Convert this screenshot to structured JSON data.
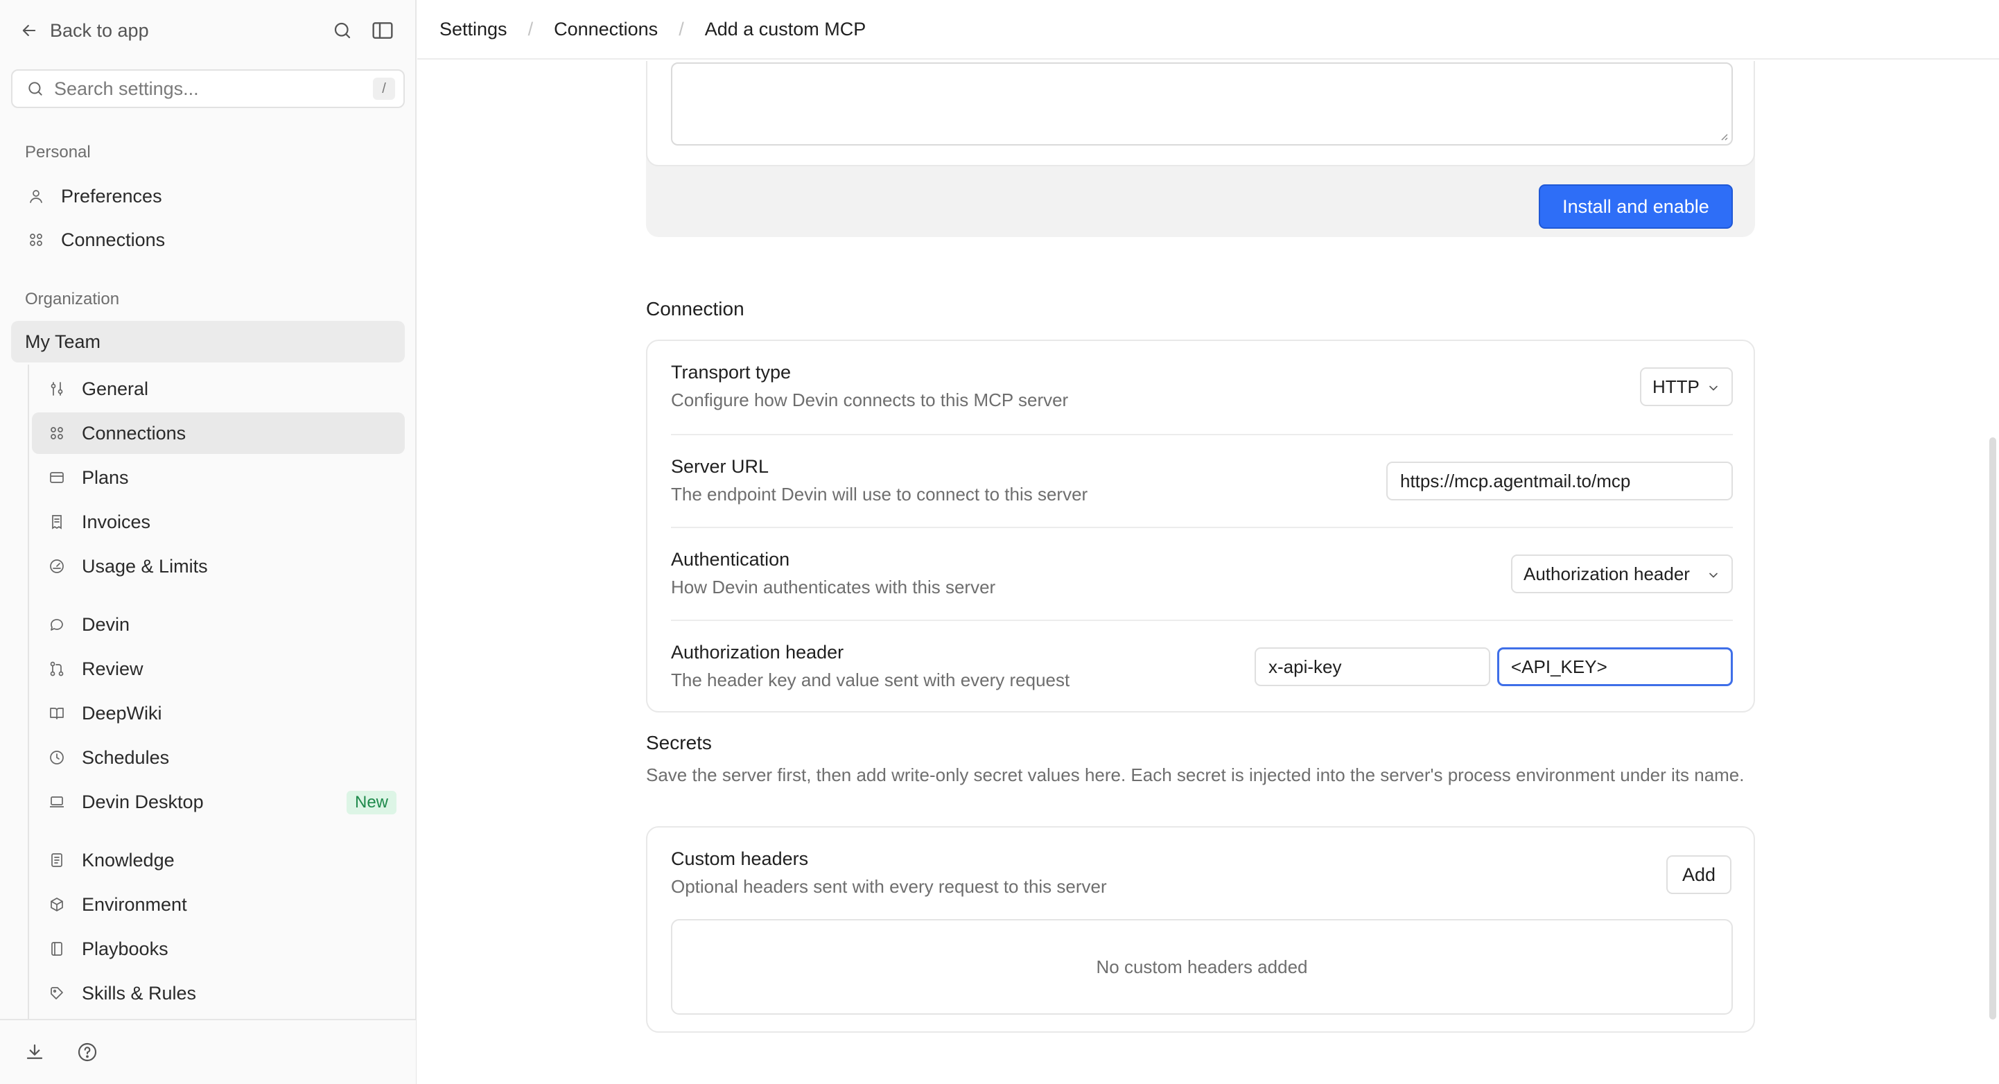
{
  "sidebar": {
    "back_label": "Back to app",
    "search_placeholder": "Search settings...",
    "search_shortcut": "/",
    "personal_label": "Personal",
    "personal_items": [
      {
        "label": "Preferences",
        "icon": "user-icon"
      },
      {
        "label": "Connections",
        "icon": "grid-icon"
      }
    ],
    "organization_label": "Organization",
    "team_label": "My Team",
    "team_items": [
      {
        "label": "General",
        "icon": "sliders-icon"
      },
      {
        "label": "Connections",
        "icon": "grid-icon",
        "active": true
      },
      {
        "label": "Plans",
        "icon": "card-icon"
      },
      {
        "label": "Invoices",
        "icon": "receipt-icon"
      },
      {
        "label": "Usage & Limits",
        "icon": "gauge-icon"
      },
      {
        "label": "Devin",
        "icon": "chat-icon"
      },
      {
        "label": "Review",
        "icon": "pull-request-icon"
      },
      {
        "label": "DeepWiki",
        "icon": "book-icon"
      },
      {
        "label": "Schedules",
        "icon": "clock-icon"
      },
      {
        "label": "Devin Desktop",
        "icon": "laptop-icon",
        "badge": "New"
      },
      {
        "label": "Knowledge",
        "icon": "document-icon"
      },
      {
        "label": "Environment",
        "icon": "cube-icon"
      },
      {
        "label": "Playbooks",
        "icon": "playbook-icon"
      },
      {
        "label": "Skills & Rules",
        "icon": "tag-icon"
      }
    ]
  },
  "header": {
    "breadcrumbs": [
      "Settings",
      "Connections",
      "Add a custom MCP"
    ]
  },
  "top_card": {
    "install_label": "Install and enable"
  },
  "connection": {
    "section_title": "Connection",
    "transport": {
      "title": "Transport type",
      "description": "Configure how Devin connects to this MCP server",
      "value": "HTTP"
    },
    "server_url": {
      "title": "Server URL",
      "description": "The endpoint Devin will use to connect to this server",
      "value": "https://mcp.agentmail.to/mcp"
    },
    "authentication": {
      "title": "Authentication",
      "description": "How Devin authenticates with this server",
      "value": "Authorization header"
    },
    "auth_header": {
      "title": "Authorization header",
      "description": "The header key and value sent with every request",
      "key_value": "x-api-key",
      "value_value": "<API_KEY>"
    }
  },
  "secrets": {
    "section_title": "Secrets",
    "description": "Save the server first, then add write-only secret values here. Each secret is injected into the server's process environment under its name.",
    "custom_headers": {
      "title": "Custom headers",
      "description": "Optional headers sent with every request to this server",
      "add_label": "Add",
      "empty_text": "No custom headers added"
    }
  },
  "colors": {
    "accent": "#2e6ef7",
    "focus_ring": "#3f6fe8",
    "badge_bg": "#ddf5e6",
    "badge_text": "#1f8a4c"
  }
}
